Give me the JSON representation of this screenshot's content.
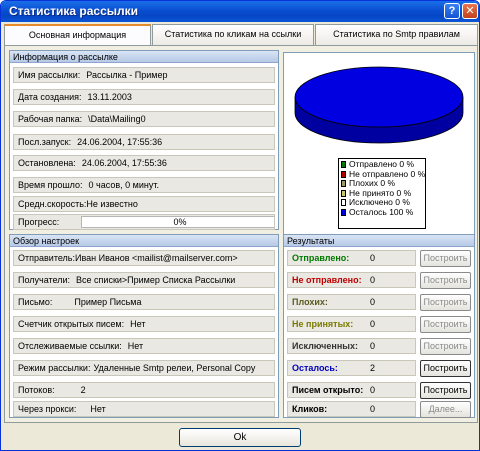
{
  "window": {
    "title": "Статистика рассылки",
    "help_glyph": "?",
    "close_glyph": "✕"
  },
  "tabs": [
    {
      "label": "Основная информация",
      "active": true
    },
    {
      "label": "Статистика по кликам на ссылки",
      "active": false
    },
    {
      "label": "Статистика по Smtp правилам",
      "active": false
    }
  ],
  "info": {
    "title": "Информация о рассылке",
    "rows": [
      {
        "label": "Имя рассылки:",
        "value": "Рассылка - Пример"
      },
      {
        "label": "Дата создания:",
        "value": "13.11.2003"
      },
      {
        "label": "Рабочая папка:",
        "value": "\\Data\\Mailing0"
      },
      {
        "label": "Посл.запуск:",
        "value": "24.06.2004, 17:55:36"
      },
      {
        "label": "Остановлена:",
        "value": "24.06.2004, 17:55:36"
      },
      {
        "label": "Время прошло:",
        "value": "0 часов, 0 минут."
      },
      {
        "label": "Средн.скорость:",
        "value": "Не известно"
      }
    ],
    "progress": {
      "label": "Прогресс:",
      "text": "0%",
      "value": 0
    }
  },
  "chart_data": {
    "type": "pie",
    "title": "",
    "categories": [
      "Отправлено 0 %",
      "Не отправлено 0 %",
      "Плохих 0 %",
      "Не принято 0 %",
      "Исключено 0 %",
      "Осталось 100 %"
    ],
    "values": [
      0,
      0,
      0,
      0,
      0,
      100
    ],
    "colors": [
      "#007a00",
      "#b40000",
      "#9a9a6a",
      "#c8c86a",
      "#ffffff",
      "#0000e0"
    ],
    "legend": "bottom-center"
  },
  "settings": {
    "title": "Обзор настроек",
    "rows": [
      {
        "label": "Отправитель:",
        "value": "Иван Иванов <mailist@mailserver.com>"
      },
      {
        "label": "Получатели:",
        "value": "Все списки>Пример Списка Рассылки"
      },
      {
        "label": "Письмо:",
        "value": "Пример Письма"
      },
      {
        "label": "Счетчик открытых писем:",
        "value": "Нет"
      },
      {
        "label": "Отслеживаемые ссылки:",
        "value": "Нет"
      },
      {
        "label": "Режим рассылки:",
        "value": "Удаленные Smtp релеи, Personal Copy"
      },
      {
        "label": "Потоков:",
        "value": "2"
      },
      {
        "label": "Через прокси:",
        "value": "Нет"
      }
    ]
  },
  "results": {
    "title": "Результаты",
    "rows": [
      {
        "label": "Отправлено:",
        "value": "0",
        "color": "#007a00",
        "button": "Построить",
        "enabled": false
      },
      {
        "label": "Не отправлено:",
        "value": "0",
        "color": "#c00000",
        "button": "Построить",
        "enabled": false
      },
      {
        "label": "Плохих:",
        "value": "0",
        "color": "#5a5a1e",
        "button": "Построить",
        "enabled": false
      },
      {
        "label": "Не принятых:",
        "value": "0",
        "color": "#7a7a00",
        "button": "Построить",
        "enabled": false
      },
      {
        "label": "Исключенных:",
        "value": "0",
        "color": "#333333",
        "button": "Построить",
        "enabled": false
      },
      {
        "label": "Осталось:",
        "value": "2",
        "color": "#0000c0",
        "button": "Построить",
        "enabled": true
      },
      {
        "label": "Писем открыто:",
        "value": "0",
        "color": "#000000",
        "button": "Построить",
        "enabled": true
      },
      {
        "label": "Кликов:",
        "value": "0",
        "color": "#000000",
        "button": "Далее...",
        "enabled": false
      }
    ]
  },
  "footer": {
    "ok_label": "Ok"
  }
}
